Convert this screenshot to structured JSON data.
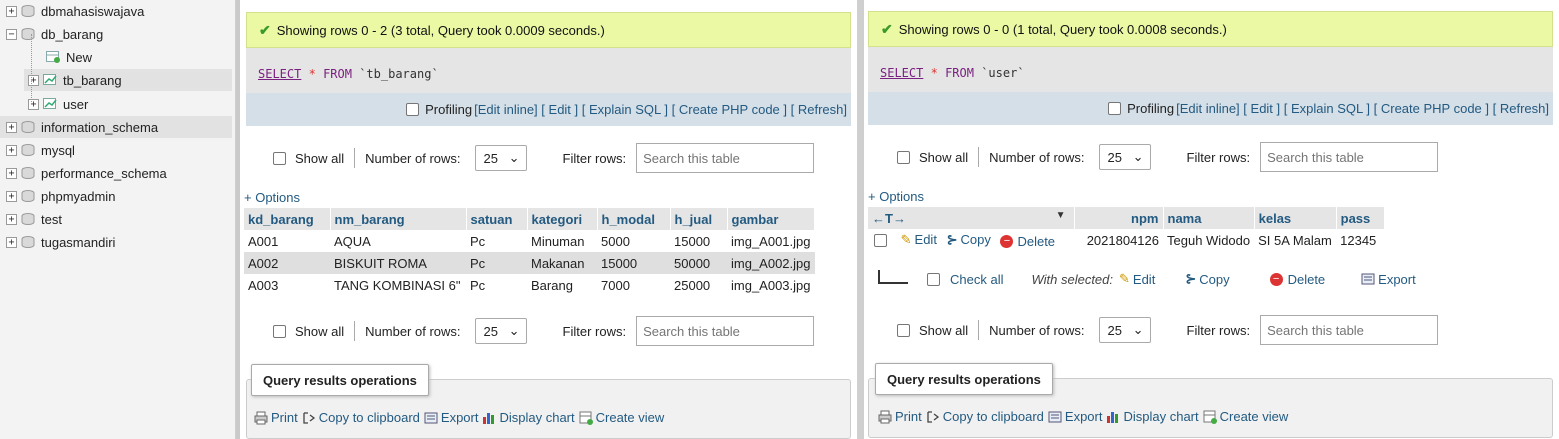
{
  "sidebar": {
    "items": [
      {
        "label": "dbmahasiswajava"
      },
      {
        "label": "db_barang"
      },
      {
        "label": "New"
      },
      {
        "label": "tb_barang"
      },
      {
        "label": "user"
      },
      {
        "label": "information_schema"
      },
      {
        "label": "mysql"
      },
      {
        "label": "performance_schema"
      },
      {
        "label": "phpmyadmin"
      },
      {
        "label": "test"
      },
      {
        "label": "tugasmandiri"
      }
    ]
  },
  "left": {
    "success": "Showing rows 0 - 2 (3 total, Query took 0.0009 seconds.)",
    "sql": {
      "select": "SELECT",
      "star": "*",
      "from": "FROM",
      "table": "`tb_barang`"
    },
    "tools": {
      "profiling": "Profiling",
      "edit_inline": "[Edit inline]",
      "edit": "[ Edit ]",
      "explain": "[ Explain SQL ]",
      "php": "[ Create PHP code ]",
      "refresh": "[ Refresh]"
    },
    "nav": {
      "show_all": "Show all",
      "num_rows_label": "Number of rows:",
      "num_rows": "25",
      "filter_label": "Filter rows:",
      "filter_placeholder": "Search this table"
    },
    "options": "+ Options",
    "columns": [
      "kd_barang",
      "nm_barang",
      "satuan",
      "kategori",
      "h_modal",
      "h_jual",
      "gambar"
    ],
    "rows": [
      [
        "A001",
        "AQUA",
        "Pc",
        "Minuman",
        "5000",
        "15000",
        "img_A001.jpg"
      ],
      [
        "A002",
        "BISKUIT ROMA",
        "Pc",
        "Makanan",
        "15000",
        "50000",
        "img_A002.jpg"
      ],
      [
        "A003",
        "TANG KOMBINASI 6\"",
        "Pc",
        "Barang",
        "7000",
        "25000",
        "img_A003.jpg"
      ]
    ],
    "ops_title": "Query results operations",
    "ops": {
      "print": "Print",
      "copy": "Copy to clipboard",
      "export": "Export",
      "chart": "Display chart",
      "view": "Create view"
    }
  },
  "right": {
    "success": "Showing rows 0 - 0 (1 total, Query took 0.0008 seconds.)",
    "sql": {
      "select": "SELECT",
      "star": "*",
      "from": "FROM",
      "table": "`user`"
    },
    "tools": {
      "profiling": "Profiling",
      "edit_inline": "[Edit inline]",
      "edit": "[ Edit ]",
      "explain": "[ Explain SQL ]",
      "php": "[ Create PHP code ]",
      "refresh": "[ Refresh]"
    },
    "nav": {
      "show_all": "Show all",
      "num_rows_label": "Number of rows:",
      "num_rows": "25",
      "filter_label": "Filter rows:",
      "filter_placeholder": "Search this table"
    },
    "options": "+ Options",
    "arrows": "←T→",
    "columns": [
      "npm",
      "nama",
      "kelas",
      "pass"
    ],
    "row": {
      "edit": "Edit",
      "copy": "Copy",
      "delete": "Delete",
      "cells": [
        "2021804126",
        "Teguh Widodo",
        "SI 5A Malam",
        "12345"
      ]
    },
    "bulk": {
      "check_all": "Check all",
      "with_selected": "With selected:",
      "edit": "Edit",
      "copy": "Copy",
      "delete": "Delete",
      "export": "Export"
    },
    "ops_title": "Query results operations",
    "ops": {
      "print": "Print",
      "copy": "Copy to clipboard",
      "export": "Export",
      "chart": "Display chart",
      "view": "Create view"
    }
  },
  "colors": {
    "success_bg": "#ebf8a4",
    "link": "#235a81",
    "sql_bg": "#e5e5e5",
    "tools_bg": "#d5dfe8",
    "keyword": "#7a2080"
  }
}
